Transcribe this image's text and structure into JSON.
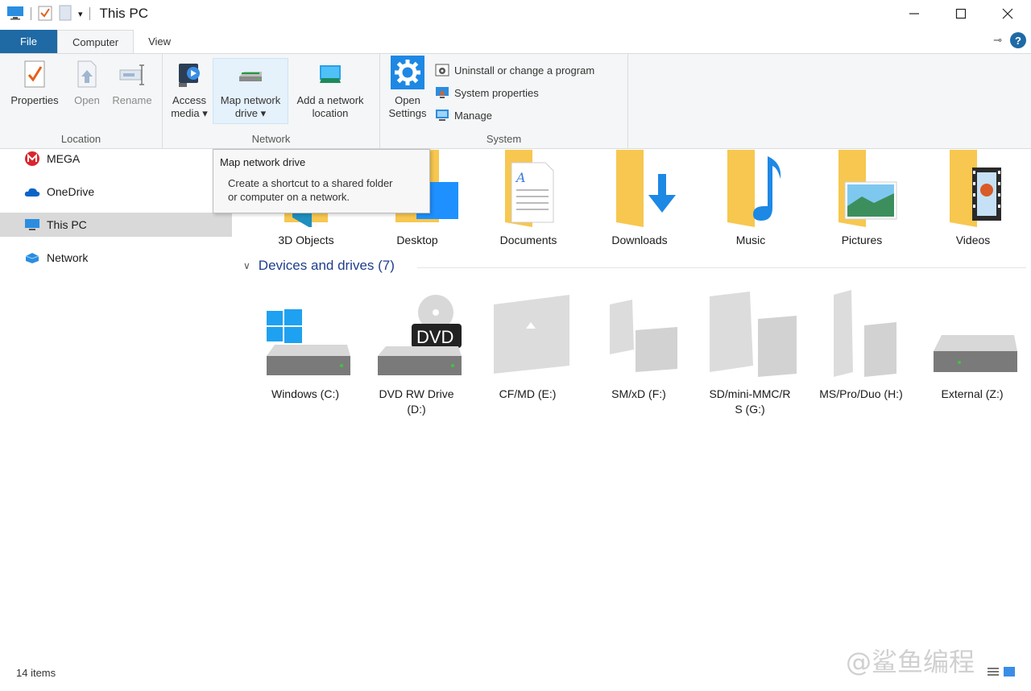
{
  "window": {
    "title": "This PC",
    "controls": {
      "minimize": "—",
      "maximize": "☐",
      "close": "✕"
    }
  },
  "ribbon": {
    "tabs": [
      "File",
      "Computer",
      "View"
    ],
    "help_icon": "?",
    "pin_icon": "⊸",
    "groups": {
      "location": {
        "label": "Location",
        "buttons": [
          "Properties",
          "Open",
          "Rename"
        ]
      },
      "network": {
        "label": "Network",
        "access_media": [
          "Access",
          "media ▾"
        ],
        "map_network_drive": [
          "Map network",
          "drive ▾"
        ],
        "add_network_location": [
          "Add a network",
          "location"
        ]
      },
      "system": {
        "label": "System",
        "open_settings": [
          "Open",
          "Settings"
        ],
        "uninstall": "Uninstall or change a program",
        "system_properties": "System properties",
        "manage": "Manage"
      }
    }
  },
  "tooltip": {
    "title": "Map network drive",
    "desc_line1": "Create a shortcut to a shared folder",
    "desc_line2": "or computer on a network."
  },
  "nav": {
    "items": [
      "MEGA",
      "OneDrive",
      "This PC",
      "Network"
    ]
  },
  "folders": [
    "3D Objects",
    "Desktop",
    "Documents",
    "Downloads",
    "Music",
    "Pictures",
    "Videos"
  ],
  "devices": {
    "header": "Devices and drives (7)",
    "items": [
      {
        "line1": "Windows (C:)",
        "line2": ""
      },
      {
        "line1": "DVD RW Drive",
        "line2": "(D:)"
      },
      {
        "line1": "CF/MD (E:)",
        "line2": ""
      },
      {
        "line1": "SM/xD (F:)",
        "line2": ""
      },
      {
        "line1": "SD/mini-MMC/R",
        "line2": "S (G:)"
      },
      {
        "line1": "MS/Pro/Duo (H:)",
        "line2": ""
      },
      {
        "line1": "External (Z:)",
        "line2": ""
      }
    ]
  },
  "status": {
    "items": "14 items"
  },
  "watermark": "@鲨鱼编程",
  "colors": {
    "file_tab": "#1f6aa5",
    "folder": "#f7c74f",
    "accent": "#0078d7"
  }
}
